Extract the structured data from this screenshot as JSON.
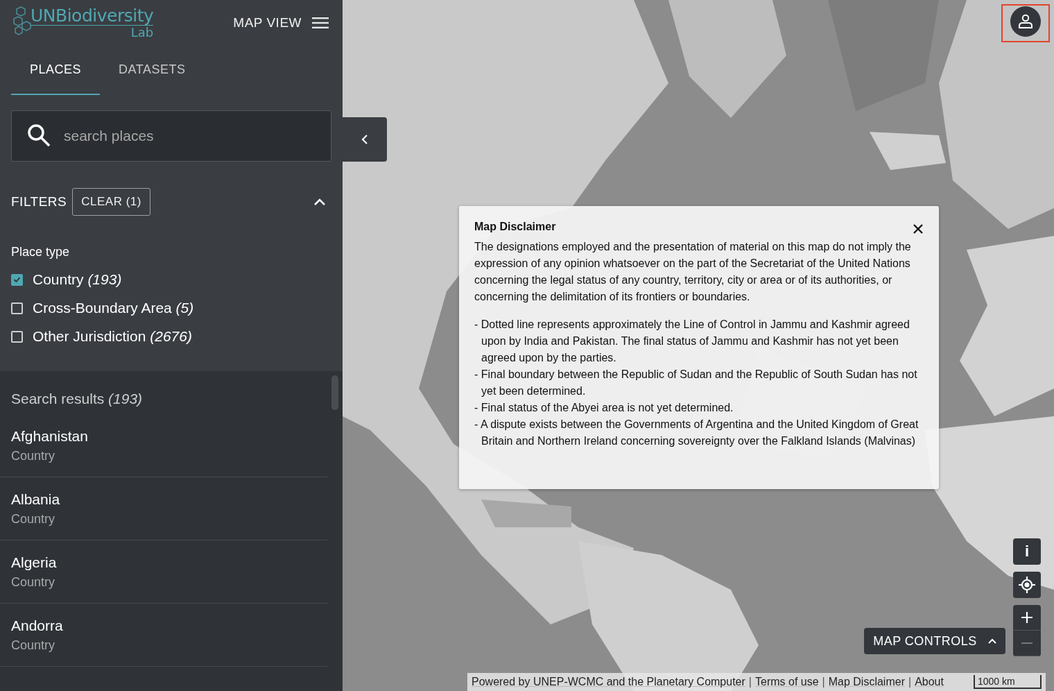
{
  "header": {
    "logo_main": "UNBiodiversity",
    "logo_sub": "Lab",
    "view_label": "MAP VIEW"
  },
  "tabs": [
    {
      "label": "PLACES",
      "selected": true
    },
    {
      "label": "DATASETS",
      "selected": false
    }
  ],
  "search": {
    "placeholder": "search places"
  },
  "filters": {
    "title": "FILTERS",
    "clear_label": "CLEAR (1)",
    "expanded": true,
    "group_title": "Place type",
    "options": [
      {
        "label": "Country",
        "count": "(193)",
        "checked": true
      },
      {
        "label": "Cross-Boundary Area",
        "count": "(5)",
        "checked": false
      },
      {
        "label": "Other Jurisdiction",
        "count": "(2676)",
        "checked": false
      }
    ]
  },
  "results": {
    "title": "Search results",
    "count": "(193)",
    "items": [
      {
        "name": "Afghanistan",
        "type": "Country"
      },
      {
        "name": "Albania",
        "type": "Country"
      },
      {
        "name": "Algeria",
        "type": "Country"
      },
      {
        "name": "Andorra",
        "type": "Country"
      }
    ]
  },
  "map": {
    "kind": "picture",
    "disclaimer": {
      "title": "Map Disclaimer",
      "intro": "The designations employed and the presentation of material on this map do not imply the expression of any opinion whatsoever on the part of the Secretariat of the United Nations concerning the legal status of any country, territory, city or area or of its authorities, or concerning the delimitation of its frontiers or boundaries.",
      "notes": [
        "- Dotted line represents approximately the Line of Control in Jammu and Kashmir agreed upon by India and Pakistan. The final status of Jammu and Kashmir has not yet been agreed upon by the parties.",
        "- Final boundary between the Republic of Sudan and the Republic of South Sudan has not yet been determined.",
        "- Final status of the Abyei area is not yet determined.",
        "- A dispute exists between the Governments of Argentina and the United Kingdom of Great Britain and Northern Ireland concerning sovereignty over the Falkland Islands (Malvinas)"
      ]
    },
    "controls_label": "MAP CONTROLS",
    "controls_expanded": true,
    "info_label": "i",
    "scale": "1000 km",
    "attribution": [
      {
        "kind": "link",
        "text": "Powered by UNEP-WCMC and the Planetary Computer"
      },
      {
        "kind": "separator",
        "text": "|"
      },
      {
        "kind": "link",
        "text": "Terms of use"
      },
      {
        "kind": "separator",
        "text": "|"
      },
      {
        "kind": "link",
        "text": "Map Disclaimer"
      },
      {
        "kind": "separator",
        "text": "|"
      },
      {
        "kind": "link",
        "text": "About"
      }
    ]
  }
}
